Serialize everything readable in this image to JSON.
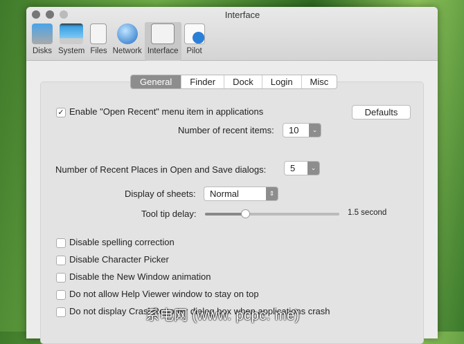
{
  "window": {
    "title": "Interface"
  },
  "toolbar": [
    {
      "label": "Disks",
      "icon": "disks-icon"
    },
    {
      "label": "System",
      "icon": "monitor-icon"
    },
    {
      "label": "Files",
      "icon": "files-icon"
    },
    {
      "label": "Network",
      "icon": "globe-icon"
    },
    {
      "label": "Interface",
      "icon": "interface-icon"
    },
    {
      "label": "Pilot",
      "icon": "pilot-icon"
    }
  ],
  "tabs": [
    "General",
    "Finder",
    "Dock",
    "Login",
    "Misc"
  ],
  "general": {
    "open_recent": "Enable \"Open Recent\" menu item in applications",
    "open_recent_checked": true,
    "defaults": "Defaults",
    "recent_items_label": "Number of recent items:",
    "recent_items_value": "10",
    "recent_places_label": "Number of Recent Places in Open and Save dialogs:",
    "recent_places_value": "5",
    "sheets_label": "Display of sheets:",
    "sheets_value": "Normal",
    "tooltip_label": "Tool tip delay:",
    "tooltip_value": "1.5 second",
    "tooltip_fraction": 0.3,
    "checkboxes": [
      "Disable spelling correction",
      "Disable Character Picker",
      "Disable the New Window animation",
      "Do not allow Help Viewer window to stay on top",
      "Do not display CrashReporter dialog box when applications crash"
    ]
  },
  "watermark": "系电网 (www. pcpc. me)"
}
